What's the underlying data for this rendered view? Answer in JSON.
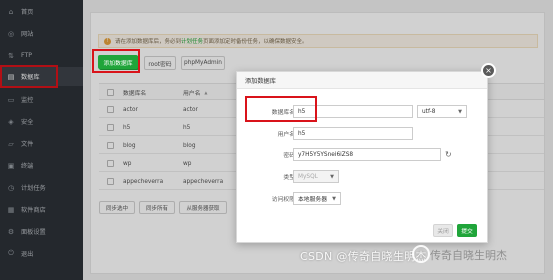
{
  "sidebar": {
    "items": [
      {
        "label": "首页",
        "icon": "home-icon",
        "glyph": "⌂"
      },
      {
        "label": "网站",
        "icon": "globe-icon",
        "glyph": "◎"
      },
      {
        "label": "FTP",
        "icon": "ftp-icon",
        "glyph": "⇅"
      },
      {
        "label": "数据库",
        "icon": "database-icon",
        "glyph": "▤",
        "active": true
      },
      {
        "label": "监控",
        "icon": "monitor-icon",
        "glyph": "▭"
      },
      {
        "label": "安全",
        "icon": "shield-icon",
        "glyph": "◈"
      },
      {
        "label": "文件",
        "icon": "folder-icon",
        "glyph": "▱"
      },
      {
        "label": "终端",
        "icon": "terminal-icon",
        "glyph": "▣"
      },
      {
        "label": "计划任务",
        "icon": "clock-icon",
        "glyph": "◷"
      },
      {
        "label": "软件商店",
        "icon": "store-icon",
        "glyph": "▦"
      },
      {
        "label": "面板设置",
        "icon": "gear-icon",
        "glyph": "⚙"
      },
      {
        "label": "退出",
        "icon": "logout-icon",
        "glyph": "⏻"
      }
    ]
  },
  "notice": {
    "pre": "请在添加数据库后，务必到",
    "link": "计划任务",
    "post": "页面添加定时备份任务，以确保数据安全。"
  },
  "toolbar": {
    "add_db": "添加数据库",
    "root_pwd": "root密码",
    "phpmyadmin": "phpMyAdmin"
  },
  "table": {
    "headers": [
      "数据库名",
      "用户名"
    ],
    "sort_glyph": "▲",
    "rows": [
      {
        "name": "actor",
        "user": "actor"
      },
      {
        "name": "h5",
        "user": "h5"
      },
      {
        "name": "blog",
        "user": "blog"
      },
      {
        "name": "wp",
        "user": "wp"
      },
      {
        "name": "appecheverra",
        "user": "appecheverra"
      }
    ]
  },
  "bulk": {
    "sync_selected": "同步选中",
    "sync_all": "同步所有",
    "from_server": "从服务器获取"
  },
  "modal": {
    "title": "添加数据库",
    "close_glyph": "×",
    "fields": {
      "db_name_label": "数据库名",
      "db_name_value": "h5",
      "charset_value": "utf-8",
      "username_label": "用户名",
      "username_value": "h5",
      "password_label": "密码",
      "password_value": "y7H5Y5YSnei6iZS8",
      "type_label": "类型",
      "type_value": "MySQL",
      "access_label": "访问权限",
      "access_value": "本地服务器"
    },
    "cancel": "关闭",
    "submit": "提交"
  },
  "watermark": {
    "csdn": "CSDN @传奇自晓生明杰",
    "wechat": "传奇自晓生明杰"
  }
}
